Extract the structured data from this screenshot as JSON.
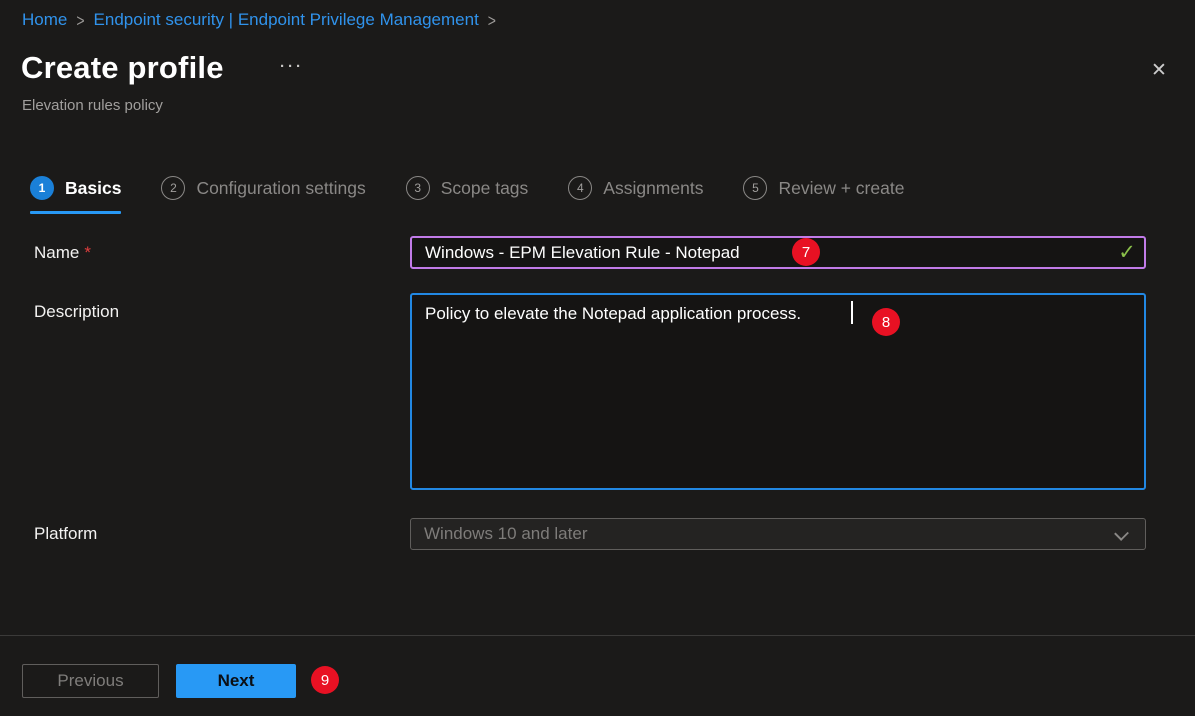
{
  "breadcrumb": {
    "home": "Home",
    "separator": ">",
    "section": "Endpoint security | Endpoint Privilege Management"
  },
  "header": {
    "title": "Create profile",
    "more_glyph": "···",
    "subtitle": "Elevation rules policy",
    "close_glyph": "✕"
  },
  "tabs": [
    {
      "number": "1",
      "label": "Basics",
      "active": true
    },
    {
      "number": "2",
      "label": "Configuration settings",
      "active": false
    },
    {
      "number": "3",
      "label": "Scope tags",
      "active": false
    },
    {
      "number": "4",
      "label": "Assignments",
      "active": false
    },
    {
      "number": "5",
      "label": "Review + create",
      "active": false
    }
  ],
  "form": {
    "name": {
      "label": "Name",
      "required_mark": "*",
      "value": "Windows - EPM Elevation Rule - Notepad",
      "valid_glyph": "✓",
      "annotation": "7"
    },
    "description": {
      "label": "Description",
      "value": "Policy to elevate the Notepad application process.",
      "annotation": "8"
    },
    "platform": {
      "label": "Platform",
      "value": "Windows 10 and later",
      "state": "disabled"
    }
  },
  "footer": {
    "previous_label": "Previous",
    "next_label": "Next",
    "annotation": "9"
  },
  "colors": {
    "background": "#1b1a19",
    "link_blue": "#3093ec",
    "accent_blue": "#2899f5",
    "name_border_purple": "#c17be8",
    "valid_green": "#8abf4a",
    "annotation_red": "#e81123",
    "text_primary": "#ffffff",
    "text_muted": "#8a8886",
    "required_red": "#e03e3e"
  }
}
